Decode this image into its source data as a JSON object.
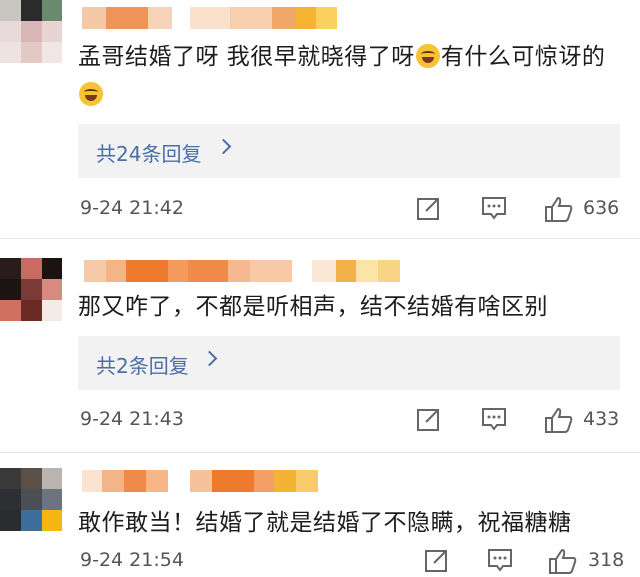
{
  "colors": {
    "link": "#4a6fa5",
    "reply_bg": "#f2f2f2",
    "emoji": "#f7c233"
  },
  "comments": [
    {
      "text_before": "孟哥结婚了呀 我很早就晓得了呀",
      "text_middle": "有什么可惊讶的",
      "text_after": "",
      "emoji": "laughing-crying-icon",
      "replies_label": "共24条回复",
      "time": "9-24 21:42",
      "likes": "636"
    },
    {
      "text_before": "那又咋了，不都是听相声，结不结婚有啥区别",
      "replies_label": "共2条回复",
      "time": "9-24 21:43",
      "likes": "433"
    },
    {
      "text_before": "敢作敢当！结婚了就是结婚了不隐瞒，祝福糖糖",
      "time": "9-24 21:54",
      "likes": "318"
    }
  ],
  "icons": [
    "share-icon",
    "comment-icon",
    "thumbs-up-icon"
  ]
}
